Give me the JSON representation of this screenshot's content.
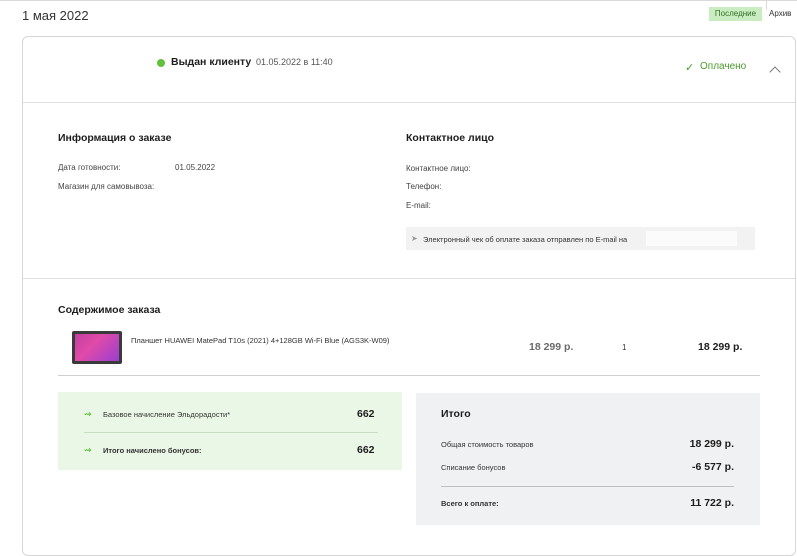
{
  "header": {
    "date": "1 мая 2022",
    "tabs": [
      {
        "label": "Последние",
        "active": true
      },
      {
        "label": "Архив",
        "active": false
      }
    ]
  },
  "order": {
    "status": "Выдан клиенту",
    "datetime": "01.05.2022 в 11:40",
    "payment_status": "Оплачено",
    "status_color": "#62c13b"
  },
  "info": {
    "title": "Информация о заказе",
    "ready_date_label": "Дата готовности:",
    "ready_date_value": "01.05.2022",
    "store_label": "Магазин для самовывоза:"
  },
  "contact": {
    "title": "Контактное лицо",
    "person_label": "Контактное лицо:",
    "phone_label": "Телефон:",
    "email_label": "E-mail:",
    "receipt_text": "Электронный чек об оплате заказа отправлен по E-mail на"
  },
  "contents": {
    "title": "Содержимое заказа",
    "items": [
      {
        "name": "Планшет HUAWEI MatePad T10s (2021) 4+128GB Wi-Fi Blue (AGS3K-W09)",
        "price": "18 299 р.",
        "qty": "1",
        "total": "18 299 р."
      }
    ]
  },
  "bonuses": {
    "base_label": "Базовое начисление Эльдорадости*",
    "base_value": "662",
    "total_label": "Итого начислено бонусов:",
    "total_value": "662"
  },
  "summary": {
    "title": "Итого",
    "goods_label": "Общая стоимость товаров",
    "goods_value": "18 299 р.",
    "bonus_writeoff_label": "Списание бонусов",
    "bonus_writeoff_value": "-6 577 р.",
    "to_pay_label": "Всего к оплате:",
    "to_pay_value": "11 722 р."
  }
}
